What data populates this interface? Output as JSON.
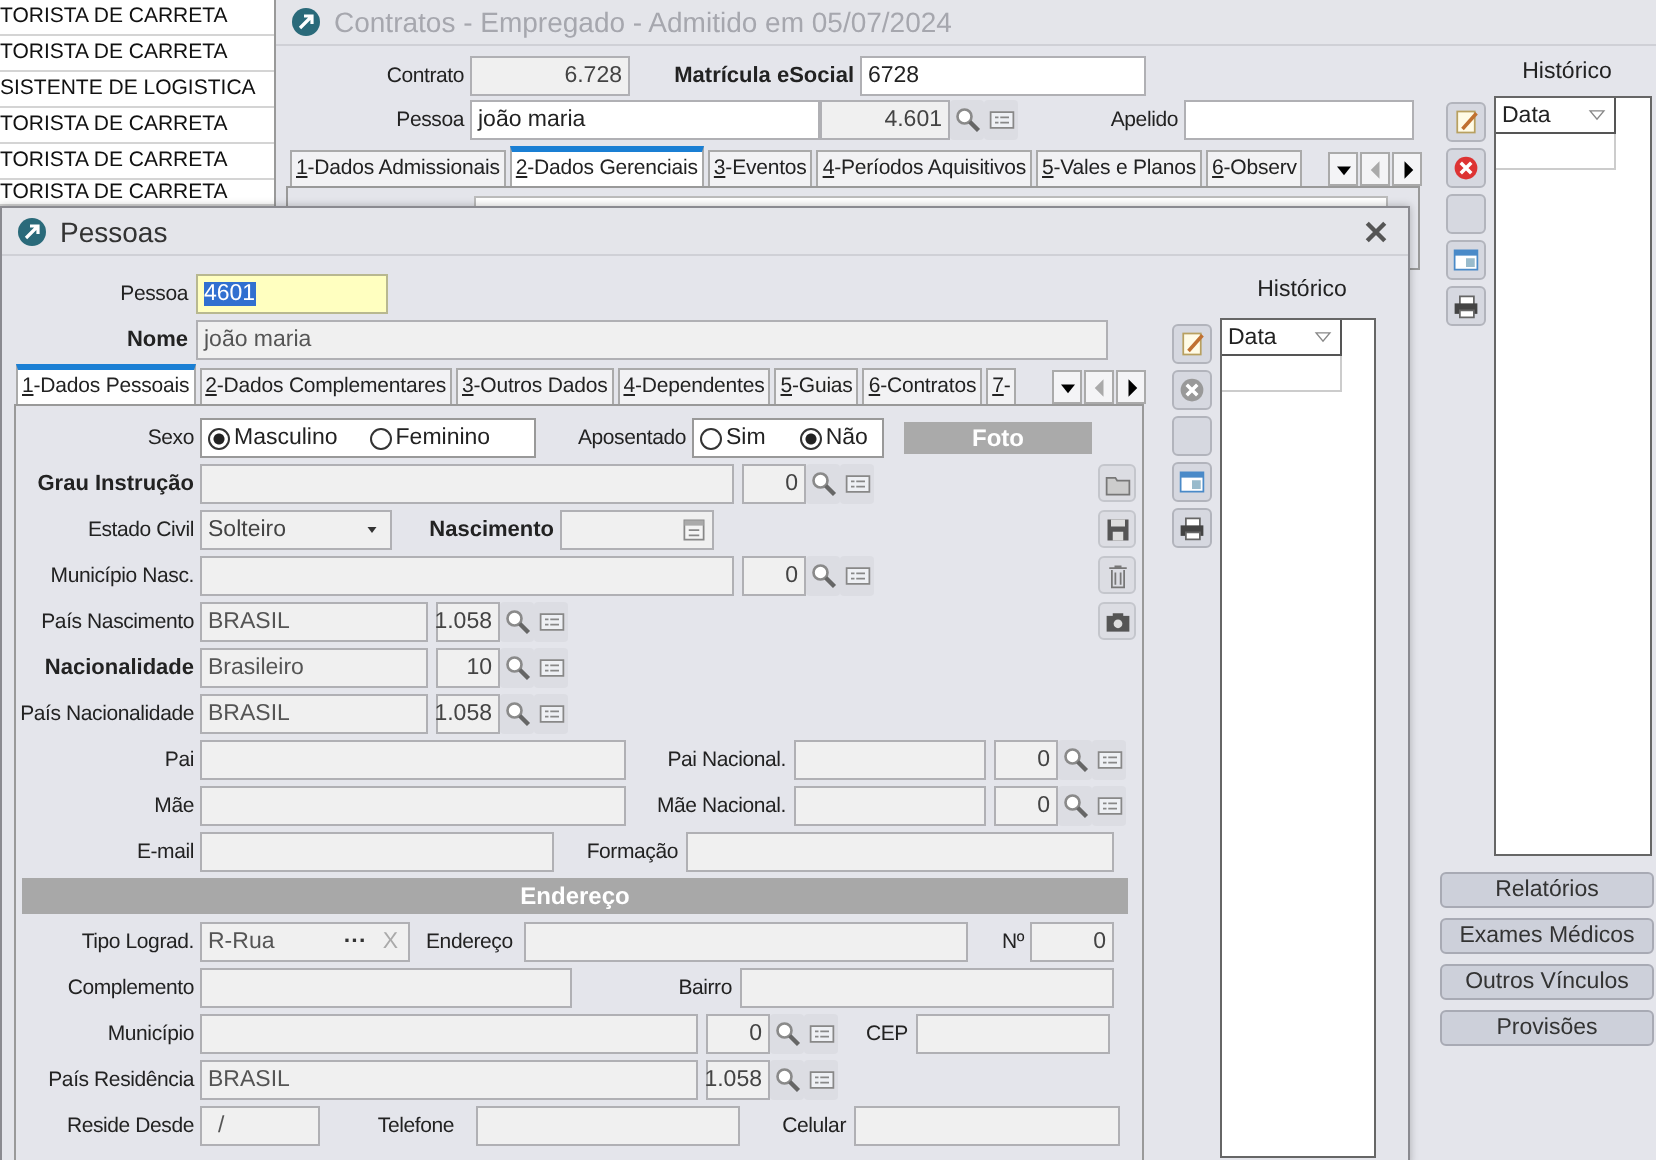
{
  "background_list": {
    "rows": [
      "TORISTA DE CARRETA",
      "TORISTA DE CARRETA",
      "SISTENTE DE LOGISTICA",
      "TORISTA DE CARRETA",
      "TORISTA DE CARRETA",
      "TORISTA DE CARRETA"
    ]
  },
  "contratos_window": {
    "title": "Contratos - Empregado - Admitido em 05/07/2024",
    "active": false,
    "contrato": {
      "label": "Contrato",
      "value": "6.728"
    },
    "matricula": {
      "label": "Matrícula eSocial",
      "value": "6728",
      "required": true
    },
    "pessoa": {
      "label": "Pessoa",
      "name": "joão maria",
      "code": "4.601"
    },
    "apelido": {
      "label": "Apelido"
    },
    "tabs": [
      {
        "label": "1-Dados Admissionais",
        "selected": false
      },
      {
        "label": "2-Dados Gerenciais",
        "selected": true
      },
      {
        "label": "3-Eventos",
        "selected": false
      },
      {
        "label": "4-Períodos Aquisitivos",
        "selected": false
      },
      {
        "label": "5-Vales e Planos",
        "selected": false
      },
      {
        "label": "6-Observ",
        "selected": false
      }
    ],
    "historico": {
      "label": "Histórico",
      "column": "Data"
    },
    "buttons": [
      "Relatórios",
      "Exames Médicos",
      "Outros Vínculos",
      "Provisões"
    ]
  },
  "pessoas_window": {
    "title": "Pessoas",
    "active": true,
    "pessoa": {
      "label": "Pessoa",
      "value": "4601",
      "text_selected": true
    },
    "nome": {
      "label": "Nome",
      "value": "joão maria",
      "required": true
    },
    "tabs": [
      {
        "label": "1-Dados Pessoais",
        "selected": true
      },
      {
        "label": "2-Dados Complementares",
        "selected": false
      },
      {
        "label": "3-Outros Dados",
        "selected": false
      },
      {
        "label": "4-Dependentes",
        "selected": false
      },
      {
        "label": "5-Guias",
        "selected": false
      },
      {
        "label": "6-Contratos",
        "selected": false
      },
      {
        "label": "7-",
        "selected": false
      }
    ],
    "historico": {
      "label": "Histórico",
      "column": "Data"
    },
    "panel": {
      "sexo": {
        "label": "Sexo",
        "options": [
          {
            "label": "Masculino",
            "selected": true
          },
          {
            "label": "Feminino",
            "selected": false
          }
        ]
      },
      "aposentado": {
        "label": "Aposentado",
        "options": [
          {
            "label": "Sim",
            "selected": false
          },
          {
            "label": "Não",
            "selected": true
          }
        ]
      },
      "photo_header": "Foto",
      "grau_instrucao": {
        "label": "Grau Instrução",
        "code": "0",
        "required": true
      },
      "estado_civil": {
        "label": "Estado Civil",
        "value": "Solteiro"
      },
      "nascimento": {
        "label": "Nascimento",
        "required": true
      },
      "municipio_nasc": {
        "label": "Município Nasc.",
        "code": "0"
      },
      "pais_nascimento": {
        "label": "País Nascimento",
        "value": "BRASIL",
        "code": "1.058"
      },
      "nacionalidade": {
        "label": "Nacionalidade",
        "value": "Brasileiro",
        "code": "10",
        "required": true
      },
      "pais_nacionalidade": {
        "label": "País Nacionalidade",
        "value": "BRASIL",
        "code": "1.058"
      },
      "pai": {
        "label": "Pai"
      },
      "pai_nacional": {
        "label": "Pai Nacional.",
        "code": "0"
      },
      "mae": {
        "label": "Mãe"
      },
      "mae_nacional": {
        "label": "Mãe Nacional.",
        "code": "0"
      },
      "email": {
        "label": "E-mail"
      },
      "formacao": {
        "label": "Formação"
      },
      "endereco_header": "Endereço",
      "tipo_lograd": {
        "label": "Tipo Lograd.",
        "value": "R-Rua",
        "more": "···",
        "clear": "X"
      },
      "endereco": {
        "label": "Endereço"
      },
      "numero": {
        "label": "Nº",
        "value": "0"
      },
      "complemento": {
        "label": "Complemento"
      },
      "bairro": {
        "label": "Bairro"
      },
      "municipio": {
        "label": "Município",
        "code": "0"
      },
      "cep": {
        "label": "CEP"
      },
      "pais_residencia": {
        "label": "País Residência",
        "value": "BRASIL",
        "code": "1.058"
      },
      "reside_desde": {
        "label": "Reside Desde",
        "value": "/"
      },
      "telefone": {
        "label": "Telefone"
      },
      "celular": {
        "label": "Celular"
      }
    }
  }
}
